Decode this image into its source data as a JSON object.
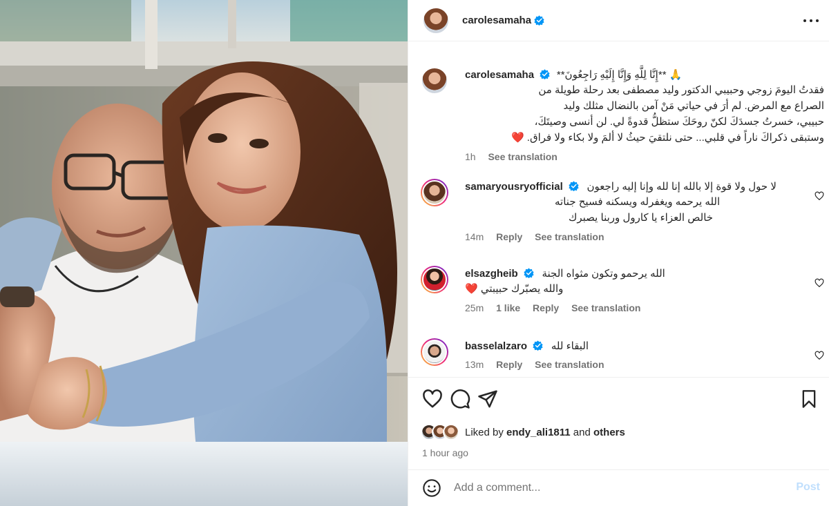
{
  "colors": {
    "verified": "#0095f6",
    "heart_red": "#ed4956",
    "link_disabled": "#c0dffd",
    "secondary_text": "#737373",
    "primary_text": "#262626"
  },
  "header": {
    "username": "carolesamaha",
    "more_icon": "more-horizontal-icon"
  },
  "caption": {
    "username": "carolesamaha",
    "title": "**إِنَّا لِلَّهِ وَإِنَّا إِلَيْهِ رَاجِعُونَ** 🙏",
    "lines": [
      "فقدتُ اليومَ زوجي وحبيبي الدكتور وليد مصطفى بعد رحلة طويلة من",
      "الصراع مع المرض. لم أرَ في حياتي مَنْ آمن بالنضال مثلك وليد",
      "حبيبي، خسرتُ جسدَكَ لكنّ روحَكَ ستظلُّ قدوةً لي. لن أنسى وصيتَكَ،",
      "وستبقى ذكراكَ ناراً في قلبي... حتى نلتقيَ حيثُ لا ألمَ ولا بكاء ولا فراق. ❤️"
    ],
    "time": "1h",
    "see_translation": "See translation"
  },
  "comments": [
    {
      "username": "samaryousryofficial",
      "lines": [
        "لا حول ولا قوة إلا بالله إنا لله وإنا إليه راجعون",
        "الله يرحمه ويغفرله ويسكنه فسيح جناته",
        "خالص العزاء يا كارول وربنا يصبرك"
      ],
      "time": "14m",
      "likes": "",
      "reply": "Reply",
      "see_translation": "See translation"
    },
    {
      "username": "elsazgheib",
      "lines": [
        "الله يرحمو وتكون مثواه الجنة",
        "والله يصبّرك حبيبتي ❤️"
      ],
      "time": "25m",
      "likes": "1 like",
      "reply": "Reply",
      "see_translation": "See translation"
    },
    {
      "username": "basselalzaro",
      "lines": [
        "البقاء لله"
      ],
      "time": "13m",
      "likes": "",
      "reply": "Reply",
      "see_translation": "See translation"
    }
  ],
  "actions": {
    "like_icon": "heart-outline-icon",
    "comment_icon": "comment-bubble-icon",
    "share_icon": "paper-plane-icon",
    "save_icon": "bookmark-icon"
  },
  "likes": {
    "prefix": "Liked by",
    "user": "endy_ali1811",
    "and": "and",
    "others": "others"
  },
  "time_ago": "1 hour ago",
  "comment_box": {
    "placeholder": "Add a comment...",
    "post_label": "Post",
    "emoji_icon": "smiley-icon"
  }
}
